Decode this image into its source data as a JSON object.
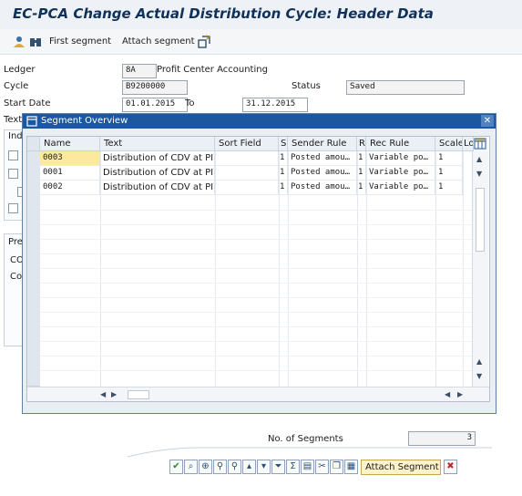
{
  "window": {
    "title": "EC-PCA Change Actual Distribution Cycle: Header Data"
  },
  "toolbar": {
    "first_segment": "First segment",
    "attach_segment": "Attach segment"
  },
  "header": {
    "ledger_label": "Ledger",
    "ledger_value": "8A",
    "ledger_text": "Profit Center Accounting",
    "cycle_label": "Cycle",
    "cycle_value": "B9200000",
    "status_label": "Status",
    "status_value": "Saved",
    "start_date_label": "Start Date",
    "start_date_value": "01.01.2015",
    "to_label": "To",
    "end_date_value": "31.12.2015",
    "text_label": "Text",
    "ind_label": "Indi",
    "pres_label": "Pres",
    "co_label": "CO",
    "cor_label": "Cor"
  },
  "dialog": {
    "title": "Segment Overview",
    "columns": [
      "Name",
      "Text",
      "Sort Field",
      "S",
      "Sender Rule",
      "R",
      "Rec Rule",
      "Scale",
      "Lo"
    ],
    "rows": [
      {
        "name": "0003",
        "text": "Distribution of CDV at PI…",
        "sort": "",
        "s": "1",
        "sender_rule": "Posted amou…",
        "r": "1",
        "rec_rule": "Variable po…",
        "scale": "1"
      },
      {
        "name": "0001",
        "text": "Distribution of CDV at PI…",
        "sort": "",
        "s": "1",
        "sender_rule": "Posted amou…",
        "r": "1",
        "rec_rule": "Variable po…",
        "scale": "1"
      },
      {
        "name": "0002",
        "text": "Distribution of CDV at PI…",
        "sort": "",
        "s": "1",
        "sender_rule": "Posted amou…",
        "r": "1",
        "rec_rule": "Variable po…",
        "scale": "1"
      }
    ],
    "no_segments_label": "No. of Segments",
    "no_segments_value": "3",
    "attach_button": "Attach Segment"
  },
  "colors": {
    "dialog_title_bg": "#1b58a0",
    "selected_cell_bg": "#fde8a0",
    "page_title": "#10315a"
  }
}
